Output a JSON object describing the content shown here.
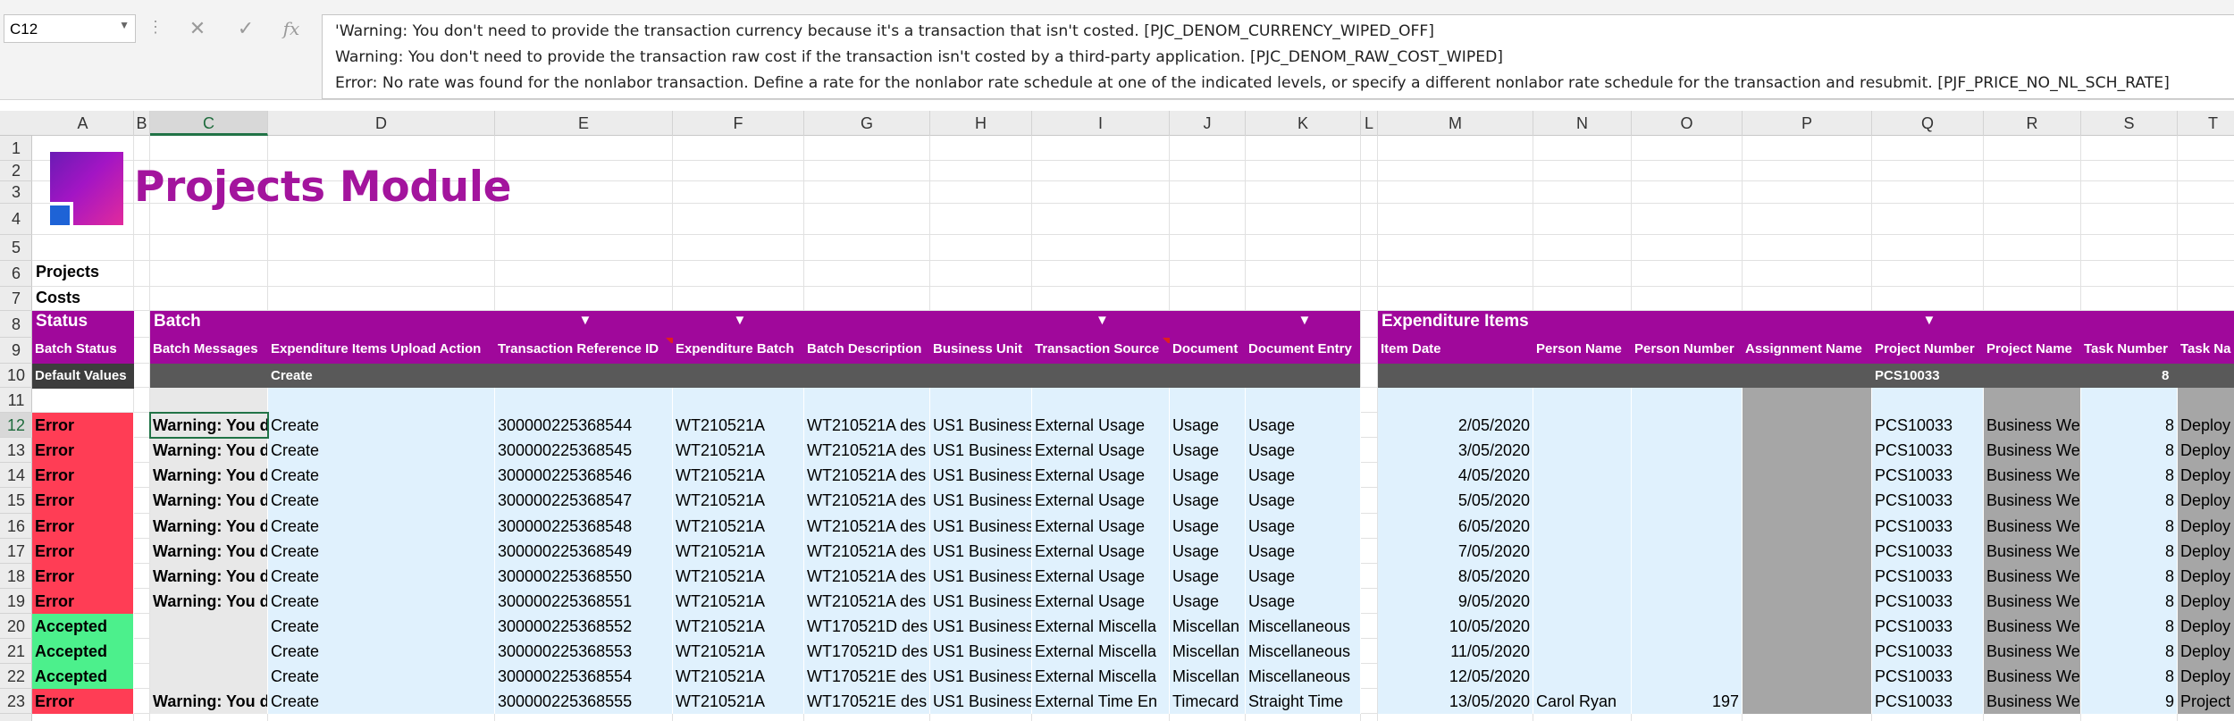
{
  "formula_bar": {
    "cell_ref": "C12",
    "fx": "fx",
    "lines": [
      "'Warning: You don't need to provide the transaction currency because it's a transaction that isn't costed. [PJC_DENOM_CURRENCY_WIPED_OFF]",
      "Warning: You don't need to provide the transaction raw cost if the transaction isn't costed by a third-party application. [PJC_DENOM_RAW_COST_WIPED]",
      "Error: No rate was found for the nonlabor transaction. Define a rate for the nonlabor rate schedule at one of the indicated levels, or specify a different nonlabor rate schedule for the transaction and resubmit. [PJF_PRICE_NO_NL_SCH_RATE]"
    ]
  },
  "column_letters": [
    "A",
    "B",
    "C",
    "D",
    "E",
    "F",
    "G",
    "H",
    "I",
    "J",
    "K",
    "L",
    "M",
    "N",
    "O",
    "P",
    "Q",
    "R",
    "S",
    "T"
  ],
  "row_numbers": [
    "1",
    "2",
    "3",
    "4",
    "5",
    "6",
    "7",
    "8",
    "9",
    "10",
    "11",
    "12",
    "13",
    "14",
    "15",
    "16",
    "17",
    "18",
    "19",
    "20",
    "21",
    "22",
    "23"
  ],
  "brand": {
    "title": "Projects Module"
  },
  "labels": {
    "projects": "Projects",
    "costs": "Costs"
  },
  "sections": {
    "status": "Status",
    "batch": "Batch",
    "expenditure_items": "Expenditure Items"
  },
  "headers": {
    "batch_status": "Batch Status",
    "batch_messages": "Batch Messages",
    "upload_action": "Expenditure Items Upload Action",
    "transaction_reference_id": "Transaction Reference ID",
    "expenditure_batch": "Expenditure Batch",
    "batch_description": "Batch Description",
    "business_unit": "Business Unit",
    "transaction_source": "Transaction Source",
    "document": "Document",
    "document_entry": "Document Entry",
    "item_date": "Item Date",
    "person_name": "Person Name",
    "person_number": "Person Number",
    "assignment_name": "Assignment Name",
    "project_number": "Project Number",
    "project_name": "Project Name",
    "task_number": "Task Number",
    "task_name": "Task Na"
  },
  "defaults": {
    "label": "Default Values",
    "upload_action": "Create",
    "project_number": "PCS10033",
    "task_number": "8"
  },
  "rows": [
    {
      "status": "Error",
      "message": "Warning: You d",
      "action": "Create",
      "ref": "300000225368544",
      "batch": "WT210521A",
      "desc": "WT210521A des",
      "bu": "US1 Business",
      "source": "External Usage",
      "doc": "Usage",
      "entry": "Usage",
      "date": "2/05/2020",
      "person": "",
      "pnum": "",
      "proj": "PCS10033",
      "pname": "Business We",
      "task": "8",
      "tname": "Deploy"
    },
    {
      "status": "Error",
      "message": "Warning: You d",
      "action": "Create",
      "ref": "300000225368545",
      "batch": "WT210521A",
      "desc": "WT210521A des",
      "bu": "US1 Business",
      "source": "External Usage",
      "doc": "Usage",
      "entry": "Usage",
      "date": "3/05/2020",
      "person": "",
      "pnum": "",
      "proj": "PCS10033",
      "pname": "Business We",
      "task": "8",
      "tname": "Deploy"
    },
    {
      "status": "Error",
      "message": "Warning: You d",
      "action": "Create",
      "ref": "300000225368546",
      "batch": "WT210521A",
      "desc": "WT210521A des",
      "bu": "US1 Business",
      "source": "External Usage",
      "doc": "Usage",
      "entry": "Usage",
      "date": "4/05/2020",
      "person": "",
      "pnum": "",
      "proj": "PCS10033",
      "pname": "Business We",
      "task": "8",
      "tname": "Deploy"
    },
    {
      "status": "Error",
      "message": "Warning: You d",
      "action": "Create",
      "ref": "300000225368547",
      "batch": "WT210521A",
      "desc": "WT210521A des",
      "bu": "US1 Business",
      "source": "External Usage",
      "doc": "Usage",
      "entry": "Usage",
      "date": "5/05/2020",
      "person": "",
      "pnum": "",
      "proj": "PCS10033",
      "pname": "Business We",
      "task": "8",
      "tname": "Deploy"
    },
    {
      "status": "Error",
      "message": "Warning: You d",
      "action": "Create",
      "ref": "300000225368548",
      "batch": "WT210521A",
      "desc": "WT210521A des",
      "bu": "US1 Business",
      "source": "External Usage",
      "doc": "Usage",
      "entry": "Usage",
      "date": "6/05/2020",
      "person": "",
      "pnum": "",
      "proj": "PCS10033",
      "pname": "Business We",
      "task": "8",
      "tname": "Deploy"
    },
    {
      "status": "Error",
      "message": "Warning: You d",
      "action": "Create",
      "ref": "300000225368549",
      "batch": "WT210521A",
      "desc": "WT210521A des",
      "bu": "US1 Business",
      "source": "External Usage",
      "doc": "Usage",
      "entry": "Usage",
      "date": "7/05/2020",
      "person": "",
      "pnum": "",
      "proj": "PCS10033",
      "pname": "Business We",
      "task": "8",
      "tname": "Deploy"
    },
    {
      "status": "Error",
      "message": "Warning: You d",
      "action": "Create",
      "ref": "300000225368550",
      "batch": "WT210521A",
      "desc": "WT210521A des",
      "bu": "US1 Business",
      "source": "External Usage",
      "doc": "Usage",
      "entry": "Usage",
      "date": "8/05/2020",
      "person": "",
      "pnum": "",
      "proj": "PCS10033",
      "pname": "Business We",
      "task": "8",
      "tname": "Deploy"
    },
    {
      "status": "Error",
      "message": "Warning: You d",
      "action": "Create",
      "ref": "300000225368551",
      "batch": "WT210521A",
      "desc": "WT210521A des",
      "bu": "US1 Business",
      "source": "External Usage",
      "doc": "Usage",
      "entry": "Usage",
      "date": "9/05/2020",
      "person": "",
      "pnum": "",
      "proj": "PCS10033",
      "pname": "Business We",
      "task": "8",
      "tname": "Deploy"
    },
    {
      "status": "Accepted",
      "message": "",
      "action": "Create",
      "ref": "300000225368552",
      "batch": "WT210521A",
      "desc": "WT170521D des",
      "bu": "US1 Business",
      "source": "External Miscella",
      "doc": "Miscellan",
      "entry": "Miscellaneous",
      "date": "10/05/2020",
      "person": "",
      "pnum": "",
      "proj": "PCS10033",
      "pname": "Business We",
      "task": "8",
      "tname": "Deploy"
    },
    {
      "status": "Accepted",
      "message": "",
      "action": "Create",
      "ref": "300000225368553",
      "batch": "WT210521A",
      "desc": "WT170521D des",
      "bu": "US1 Business",
      "source": "External Miscella",
      "doc": "Miscellan",
      "entry": "Miscellaneous",
      "date": "11/05/2020",
      "person": "",
      "pnum": "",
      "proj": "PCS10033",
      "pname": "Business We",
      "task": "8",
      "tname": "Deploy"
    },
    {
      "status": "Accepted",
      "message": "",
      "action": "Create",
      "ref": "300000225368554",
      "batch": "WT210521A",
      "desc": "WT170521E des",
      "bu": "US1 Business",
      "source": "External Miscella",
      "doc": "Miscellan",
      "entry": "Miscellaneous",
      "date": "12/05/2020",
      "person": "",
      "pnum": "",
      "proj": "PCS10033",
      "pname": "Business We",
      "task": "8",
      "tname": "Deploy"
    },
    {
      "status": "Error",
      "message": "Warning: You d",
      "action": "Create",
      "ref": "300000225368555",
      "batch": "WT210521A",
      "desc": "WT170521E des",
      "bu": "US1 Business",
      "source": "External Time En",
      "doc": "Timecard",
      "entry": "Straight Time",
      "date": "13/05/2020",
      "person": "Carol Ryan",
      "pnum": "197",
      "proj": "PCS10033",
      "pname": "Business We",
      "task": "9",
      "tname": "Project"
    }
  ],
  "colors": {
    "band": "#a0089b",
    "error": "#ff3d55",
    "accepted": "#4cf08c",
    "input_bg": "#e0f1fd",
    "locked_bg": "#a6a6a6",
    "default_bar": "#595959"
  },
  "icons": {
    "cancel": "close-icon",
    "enter": "check-icon",
    "insert_function": "fx-icon",
    "namebox_dropdown": "chevron-down-icon"
  }
}
